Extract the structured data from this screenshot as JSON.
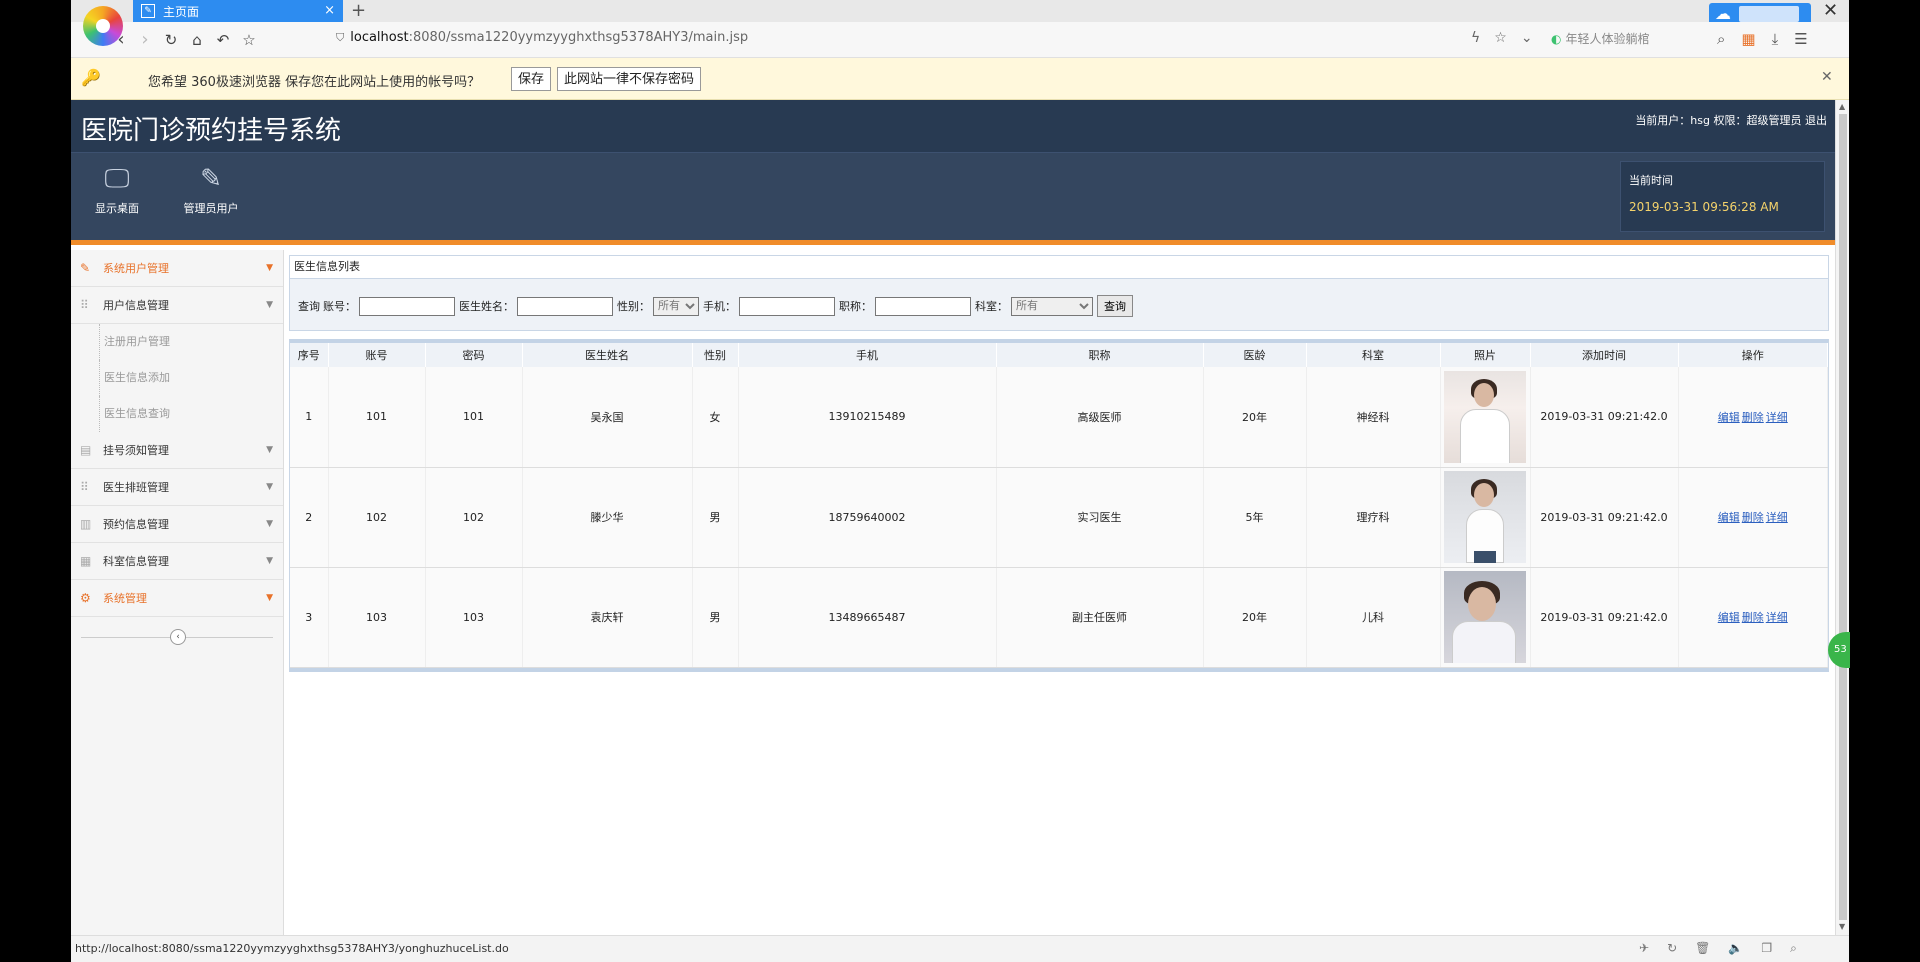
{
  "browser": {
    "tab_title": "主页面",
    "tab_close": "×",
    "new_tab": "+",
    "win_close": "✕",
    "url_host": "localhost",
    "url_path": ":8080/ssma1220yymzyyghxthsg5378AHY3/main.jsp",
    "search_placeholder": "年轻人体验躺棺",
    "password_prompt": "您希望 360极速浏览器 保存您在此网站上使用的帐号吗？",
    "save_btn": "保存",
    "never_btn": "此网站一律不保存密码",
    "status_url": "http://localhost:8080/ssma1220yymzyyghxthsg5378AHY3/yonghuzhuceList.do",
    "float_badge": "53"
  },
  "header": {
    "title": "医院门诊预约挂号系统",
    "user_info": "当前用户：hsg  权限：超级管理员  退出",
    "btn_desktop": "显示桌面",
    "btn_admin": "管理员用户",
    "time_label": "当前时间",
    "time_value": "2019-03-31 09:56:28 AM"
  },
  "sidebar": {
    "items": [
      {
        "label": "系统用户管理",
        "icon": "pencil-icon",
        "active": true
      },
      {
        "label": "用户信息管理",
        "icon": "grid-icon",
        "active": false
      }
    ],
    "sub_items": [
      "注册用户管理",
      "医生信息添加",
      "医生信息查询"
    ],
    "items2": [
      {
        "label": "挂号须知管理",
        "icon": "doc-icon"
      },
      {
        "label": "医生排班管理",
        "icon": "grid-icon"
      },
      {
        "label": "预约信息管理",
        "icon": "list-icon"
      },
      {
        "label": "科室信息管理",
        "icon": "calendar-icon"
      },
      {
        "label": "系统管理",
        "icon": "gear-icon",
        "active": true
      }
    ]
  },
  "panel": {
    "title": "医生信息列表",
    "query_label": "查询",
    "f_account": "账号：",
    "f_name": "医生姓名：",
    "f_gender": "性别：",
    "gender_value": "所有",
    "f_phone": "手机：",
    "f_title": "职称：",
    "f_dept": "科室：",
    "dept_value": "所有",
    "query_btn": "查询"
  },
  "table": {
    "headers": [
      "序号",
      "账号",
      "密码",
      "医生姓名",
      "性别",
      "手机",
      "职称",
      "医龄",
      "科室",
      "照片",
      "添加时间",
      "操作"
    ],
    "ops": [
      "编辑",
      "删除",
      "详细"
    ],
    "rows": [
      [
        "1",
        "101",
        "101",
        "吴永国",
        "女",
        "13910215489",
        "高级医师",
        "20年",
        "神经科",
        "",
        "2019-03-31 09:21:42.0"
      ],
      [
        "2",
        "102",
        "102",
        "滕少华",
        "男",
        "18759640002",
        "实习医生",
        "5年",
        "理疗科",
        "",
        "2019-03-31 09:21:42.0"
      ],
      [
        "3",
        "103",
        "103",
        "袁庆轩",
        "男",
        "13489665487",
        "副主任医师",
        "20年",
        "儿科",
        "",
        "2019-03-31 09:21:42.0"
      ]
    ]
  }
}
